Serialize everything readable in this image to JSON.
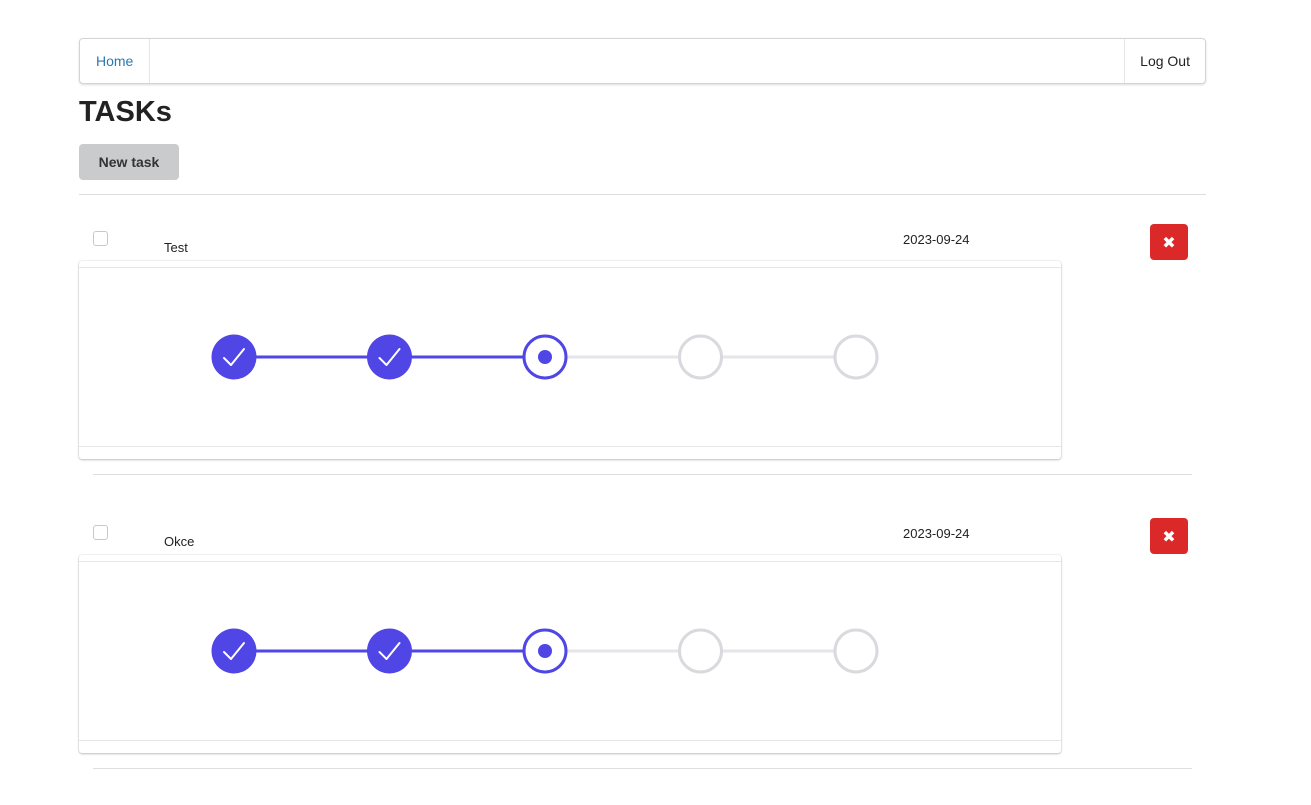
{
  "nav": {
    "home_label": "Home",
    "logout_label": "Log Out"
  },
  "page": {
    "title": "TASKs",
    "new_task_label": "New task"
  },
  "tasks": [
    {
      "name": "Test",
      "date": "2023-09-24",
      "checked": false,
      "steps": [
        "completed",
        "completed",
        "current",
        "pending",
        "pending"
      ]
    },
    {
      "name": "Okce",
      "date": "2023-09-24",
      "checked": false,
      "steps": [
        "completed",
        "completed",
        "current",
        "pending",
        "pending"
      ]
    }
  ],
  "icons": {
    "delete": "close-icon",
    "step_done": "check-icon"
  },
  "colors": {
    "accent": "#4f46e5",
    "step_pending": "#d9d9de",
    "delete": "#db2828",
    "link": "#2a7ab0"
  }
}
